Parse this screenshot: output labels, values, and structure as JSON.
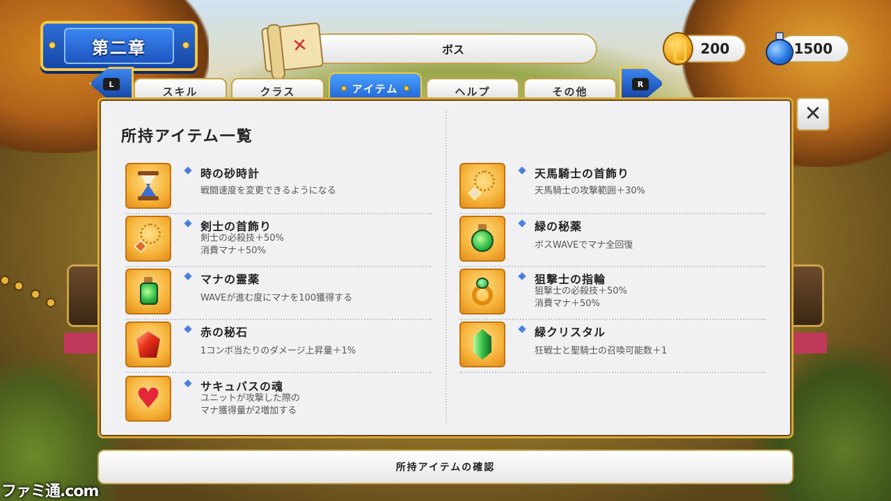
{
  "header": {
    "chapter": "第二章",
    "stage_title": "ボス"
  },
  "currency": {
    "coins": "200",
    "mana": "1500"
  },
  "tabs": {
    "prev_key": "L",
    "next_key": "R",
    "items": [
      {
        "label": "スキル",
        "active": false
      },
      {
        "label": "クラス",
        "active": false
      },
      {
        "label": "アイテム",
        "active": true
      },
      {
        "label": "ヘルプ",
        "active": false
      },
      {
        "label": "その他",
        "active": false
      }
    ]
  },
  "panel": {
    "title": "所持アイテム一覧",
    "close_symbol": "✕"
  },
  "items_left": [
    {
      "name": "時の砂時計",
      "icon": "hourglass-icon",
      "desc1": "戦闘速度を変更できるようになる",
      "desc2": ""
    },
    {
      "name": "剣士の首飾り",
      "icon": "necklace-icon",
      "desc1": "剣士の必殺技＋50%",
      "desc2": "消費マナ＋50%"
    },
    {
      "name": "マナの霊薬",
      "icon": "green-potion-icon",
      "desc1": "WAVEが進む度にマナを100獲得する",
      "desc2": ""
    },
    {
      "name": "赤の秘石",
      "icon": "red-gem-icon",
      "desc1": "1コンボ当たりのダメージ上昇量＋1%",
      "desc2": ""
    },
    {
      "name": "サキュバスの魂",
      "icon": "heart-icon",
      "desc1": "ユニットが攻撃した際の",
      "desc2": "マナ獲得量が2増加する"
    }
  ],
  "items_right": [
    {
      "name": "天馬騎士の首飾り",
      "icon": "necklace-icon",
      "desc1": "天馬騎士の攻撃範囲＋30%",
      "desc2": ""
    },
    {
      "name": "緑の秘薬",
      "icon": "green-flask-icon",
      "desc1": "ボスWAVEでマナ全回復",
      "desc2": ""
    },
    {
      "name": "狙撃士の指輪",
      "icon": "ring-icon",
      "desc1": "狙撃士の必殺技＋50%",
      "desc2": "消費マナ＋50%"
    },
    {
      "name": "緑クリスタル",
      "icon": "green-crystal-icon",
      "desc1": "狂戦士と聖騎士の召喚可能数＋1",
      "desc2": ""
    }
  ],
  "footer": {
    "button_label": "所持アイテムの確認"
  },
  "watermark": "ファミ通.com",
  "colors": {
    "accent_blue": "#1d5fd0",
    "gold_border": "#c8a24a",
    "panel_bg": "#f1f1f3"
  }
}
